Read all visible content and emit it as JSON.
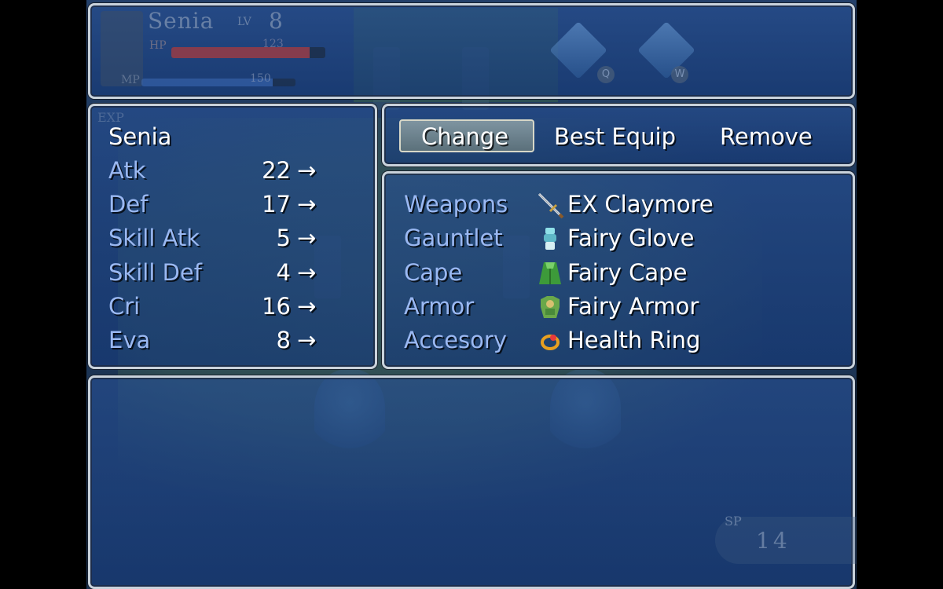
{
  "hud": {
    "actor_name": "Senia",
    "level_label": "LV",
    "level": "8",
    "hp_label": "HP",
    "hp_value": "123",
    "hp_fill_fraction": 0.9,
    "mp_label": "MP",
    "mp_value": "150",
    "mp_fill_fraction": 0.85,
    "exp_label": "EXP",
    "skill_keys": [
      "Q",
      "W"
    ],
    "sp_label": "SP",
    "sp_value": "14"
  },
  "status": {
    "actor_name": "Senia",
    "stats": [
      {
        "label": "Atk",
        "value": "22",
        "arrow": "→"
      },
      {
        "label": "Def",
        "value": "17",
        "arrow": "→"
      },
      {
        "label": "Skill Atk",
        "value": "5",
        "arrow": "→"
      },
      {
        "label": "Skill Def",
        "value": "4",
        "arrow": "→"
      },
      {
        "label": "Cri",
        "value": "16",
        "arrow": "→"
      },
      {
        "label": "Eva",
        "value": "8",
        "arrow": "→"
      }
    ]
  },
  "commands": {
    "change": "Change",
    "best_equip": "Best Equip",
    "remove": "Remove",
    "selected": "Change"
  },
  "equipment": [
    {
      "slot": "Weapons",
      "item": "EX Claymore",
      "icon": "sword-icon"
    },
    {
      "slot": "Gauntlet",
      "item": "Fairy Glove",
      "icon": "glove-icon"
    },
    {
      "slot": "Cape",
      "item": "Fairy Cape",
      "icon": "cape-icon"
    },
    {
      "slot": "Armor",
      "item": "Fairy Armor",
      "icon": "armor-icon"
    },
    {
      "slot": "Accesory",
      "item": "Health Ring",
      "icon": "ring-icon"
    }
  ],
  "colors": {
    "system_text": "#9ab8f2",
    "normal_text": "#ffffff",
    "window_border": "#c9d2db"
  }
}
